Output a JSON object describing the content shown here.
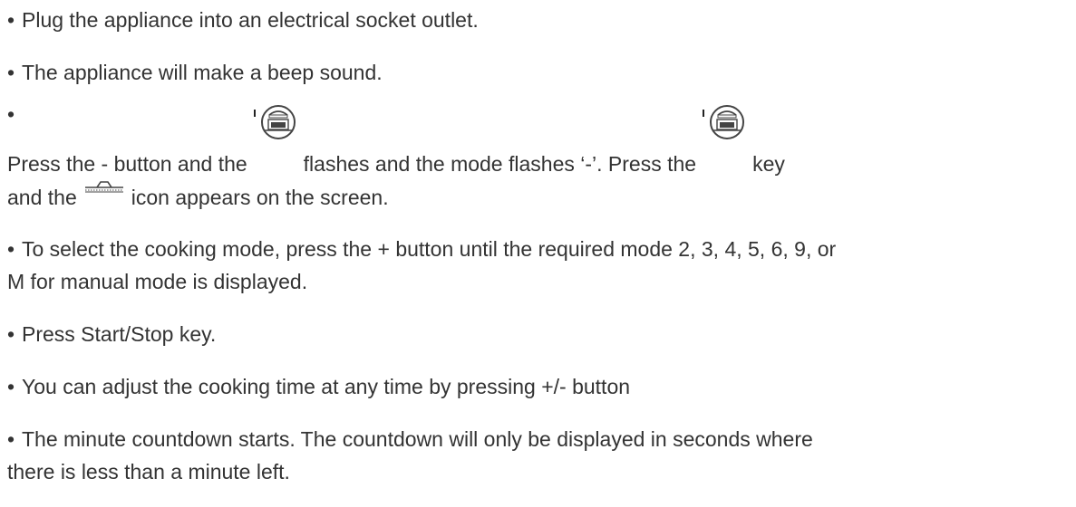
{
  "items": [
    {
      "text": "Plug the appliance into an electrical socket outlet."
    },
    {
      "text": "The appliance will make a beep sound."
    },
    {
      "part1": "Press the - button and the",
      "part2": "flashes and the mode flashes ‘-’. Press the",
      "part3": "key",
      "part4": "and the",
      "part5": "icon appears on the screen."
    },
    {
      "line1": "To select the cooking mode, press the + button until the required mode 2, 3, 4, 5, 6, 9, or",
      "line2": "M for manual mode is displayed."
    },
    {
      "text": "Press Start/Stop key."
    },
    {
      "text": "You can adjust the cooking time at any time by pressing +/- button"
    },
    {
      "line1": "The minute countdown starts. The countdown will only be displayed in seconds where",
      "line2": "there is less than a minute left."
    }
  ],
  "bullet": "•",
  "icons": {
    "steam_cook": "steam-pot-icon",
    "flat_tray": "tray-icon"
  }
}
